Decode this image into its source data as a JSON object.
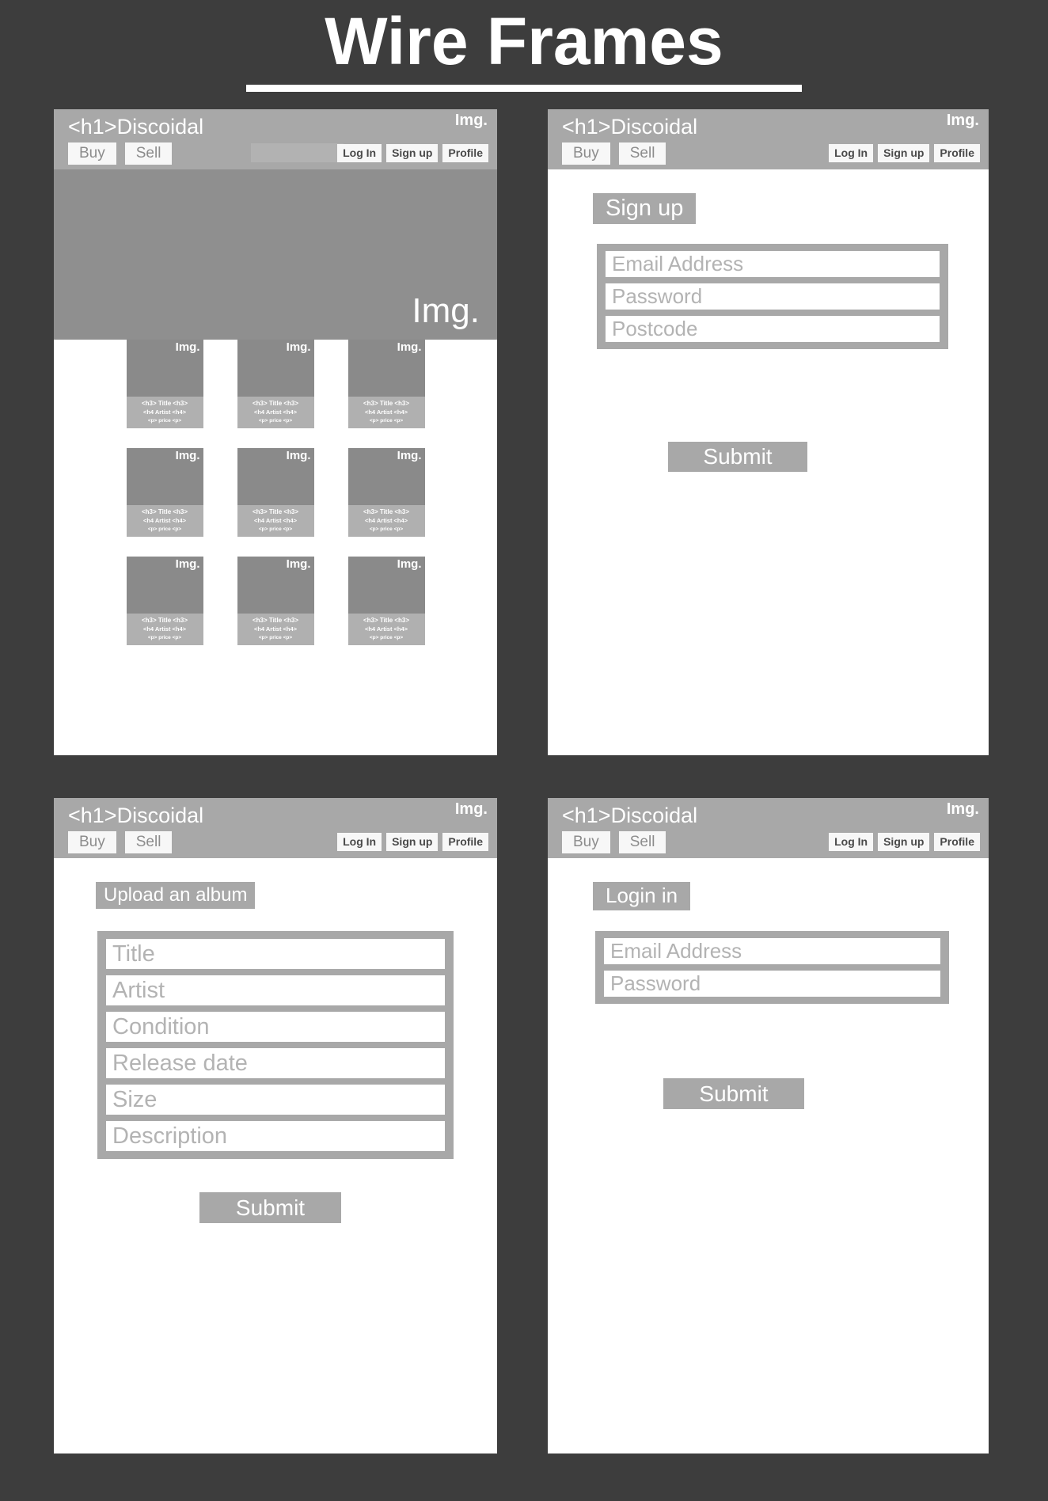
{
  "page": {
    "title": "Wire Frames",
    "background_color": "#3d3d3d"
  },
  "colors": {
    "page_bg": "#3d3d3d",
    "panel_bg": "#ffffff",
    "header_bar": "#a8a8a8",
    "hero_bg": "#8f8f8f",
    "card_img": "#8a8a8a",
    "card_meta": "#b0b0b0",
    "button_light": "#f7f7f7",
    "placeholder_text": "#b3b3b3",
    "white": "#ffffff"
  },
  "header": {
    "logo": "<h1>Discoidal",
    "img_label": "Img.",
    "nav_left": [
      {
        "label": "Buy"
      },
      {
        "label": "Sell"
      }
    ],
    "search_placeholder": "",
    "nav_right": [
      {
        "label": "Log In"
      },
      {
        "label": "Sign up"
      },
      {
        "label": "Profile"
      }
    ]
  },
  "screens": {
    "home": {
      "name": "home-browse-screen",
      "hero_label": "Img.",
      "cards": [
        {
          "img_label": "Img.",
          "title": "<h3> Title <h3>",
          "artist": "<h4 Artist <h4>",
          "price": "<p> price <p>"
        },
        {
          "img_label": "Img.",
          "title": "<h3> Title <h3>",
          "artist": "<h4 Artist <h4>",
          "price": "<p> price <p>"
        },
        {
          "img_label": "Img.",
          "title": "<h3> Title <h3>",
          "artist": "<h4 Artist <h4>",
          "price": "<p> price <p>"
        },
        {
          "img_label": "Img.",
          "title": "<h3> Title <h3>",
          "artist": "<h4 Artist <h4>",
          "price": "<p> price <p>"
        },
        {
          "img_label": "Img.",
          "title": "<h3> Title <h3>",
          "artist": "<h4 Artist <h4>",
          "price": "<p> price <p>"
        },
        {
          "img_label": "Img.",
          "title": "<h3> Title <h3>",
          "artist": "<h4 Artist <h4>",
          "price": "<p> price <p>"
        },
        {
          "img_label": "Img.",
          "title": "<h3> Title <h3>",
          "artist": "<h4 Artist <h4>",
          "price": "<p> price <p>"
        },
        {
          "img_label": "Img.",
          "title": "<h3> Title <h3>",
          "artist": "<h4 Artist <h4>",
          "price": "<p> price <p>"
        },
        {
          "img_label": "Img.",
          "title": "<h3> Title <h3>",
          "artist": "<h4 Artist <h4>",
          "price": "<p> price <p>"
        }
      ]
    },
    "signup": {
      "name": "sign-up-screen",
      "heading": "Sign up",
      "fields": [
        {
          "placeholder": "Email Address"
        },
        {
          "placeholder": "Password"
        },
        {
          "placeholder": "Postcode"
        }
      ],
      "submit_label": "Submit"
    },
    "upload": {
      "name": "upload-album-screen",
      "heading": "Upload an album",
      "fields": [
        {
          "placeholder": "Title"
        },
        {
          "placeholder": "Artist"
        },
        {
          "placeholder": "Condition"
        },
        {
          "placeholder": "Release date"
        },
        {
          "placeholder": "Size"
        },
        {
          "placeholder": "Description"
        }
      ],
      "submit_label": "Submit"
    },
    "login": {
      "name": "login-screen",
      "heading": "Login in",
      "fields": [
        {
          "placeholder": "Email Address"
        },
        {
          "placeholder": "Password"
        }
      ],
      "submit_label": "Submit"
    }
  }
}
